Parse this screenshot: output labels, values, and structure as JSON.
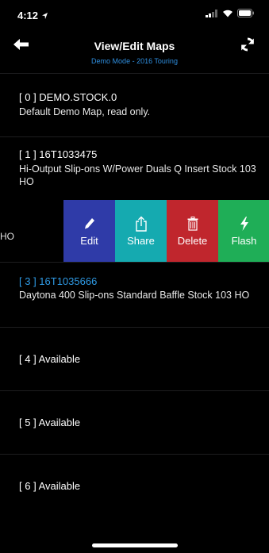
{
  "status": {
    "time": "4:12"
  },
  "nav": {
    "title": "View/Edit Maps",
    "subtitle": "Demo Mode - 2016 Touring",
    "back_icon": "back-arrow-icon",
    "refresh_icon": "refresh-icon"
  },
  "rows": [
    {
      "title": "[ 0 ] DEMO.STOCK.0",
      "desc": "Default Demo Map, read only."
    },
    {
      "title": "[ 1 ] 16T1033475",
      "desc": "Hi-Output Slip-ons W/Power Duals Q Insert Stock 103 HO"
    },
    {
      "partial": "HO"
    },
    {
      "title": "[ 3 ] 16T1035666",
      "desc": "Daytona 400 Slip-ons Standard Baffle Stock 103 HO"
    },
    {
      "title": "[ 4 ] Available"
    },
    {
      "title": "[ 5 ] Available"
    },
    {
      "title": "[ 6 ] Available"
    }
  ],
  "swipe_actions": [
    {
      "label": "Edit",
      "icon": "pencil-icon",
      "color": "#2f3ba8"
    },
    {
      "label": "Share",
      "icon": "share-icon",
      "color": "#15aab0"
    },
    {
      "label": "Delete",
      "icon": "trash-icon",
      "color": "#c0262d"
    },
    {
      "label": "Flash",
      "icon": "lightning-icon",
      "color": "#1fae57"
    }
  ],
  "colors": {
    "accent": "#2f9be6",
    "background": "#000000"
  }
}
